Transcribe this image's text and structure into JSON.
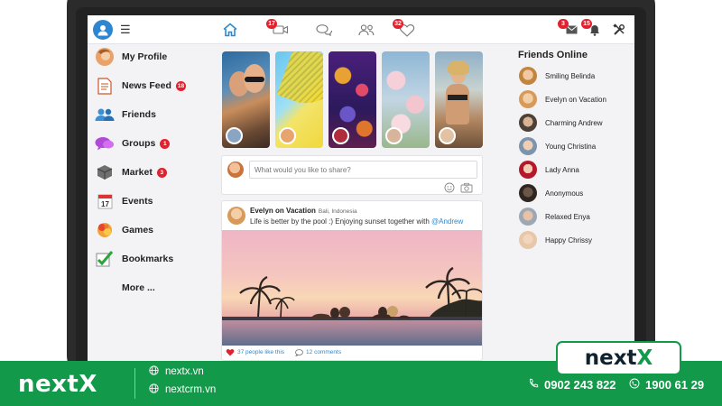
{
  "topbar": {
    "badges": {
      "video": "17",
      "likes": "32",
      "messages": "3",
      "notifications": "15"
    },
    "icons": [
      "user-avatar-icon",
      "menu-icon",
      "home-icon",
      "video-icon",
      "chat-icon",
      "friends-icon",
      "heart-icon",
      "mail-icon",
      "bell-icon",
      "settings-icon"
    ]
  },
  "sidebar": {
    "items": [
      {
        "label": "My Profile",
        "icon": "profile-avatar-icon",
        "badge": ""
      },
      {
        "label": "News Feed",
        "icon": "newsfeed-icon",
        "badge": "18"
      },
      {
        "label": "Friends",
        "icon": "friends-icon",
        "badge": ""
      },
      {
        "label": "Groups",
        "icon": "groups-icon",
        "badge": "1"
      },
      {
        "label": "Market",
        "icon": "market-icon",
        "badge": "3"
      },
      {
        "label": "Events",
        "icon": "calendar-icon",
        "badge": ""
      },
      {
        "label": "Games",
        "icon": "games-icon",
        "badge": ""
      },
      {
        "label": "Bookmarks",
        "icon": "checkmark-icon",
        "badge": ""
      },
      {
        "label": "More ...",
        "icon": "",
        "badge": ""
      }
    ]
  },
  "composer": {
    "placeholder": "What would you like to share?"
  },
  "post": {
    "author": "Evelyn on Vacation",
    "location": "Bali, Indonesia",
    "text": "Life is better by the pool :) Enjoying sunset together with ",
    "mention": "@Andrew",
    "likes_text": "37 people like this",
    "comments_text": "12 comments"
  },
  "friends_online": {
    "title": "Friends Online",
    "friends": [
      "Smiling Belinda",
      "Evelyn on Vacation",
      "Charming Andrew",
      "Young Christina",
      "Lady Anna",
      "Anonymous",
      "Relaxed Enya",
      "Happy Chrissy"
    ]
  },
  "branding": {
    "name_left": "nextX",
    "logo_prefix": "next",
    "logo_suffix": "X",
    "links": [
      "nextx.vn",
      "nextcrm.vn"
    ],
    "phones": [
      "0902 243 822",
      "1900 61 29"
    ]
  },
  "colors": {
    "brand_green": "#129a4a",
    "badge_red": "#e1222e",
    "link_blue": "#2a8ad1"
  }
}
